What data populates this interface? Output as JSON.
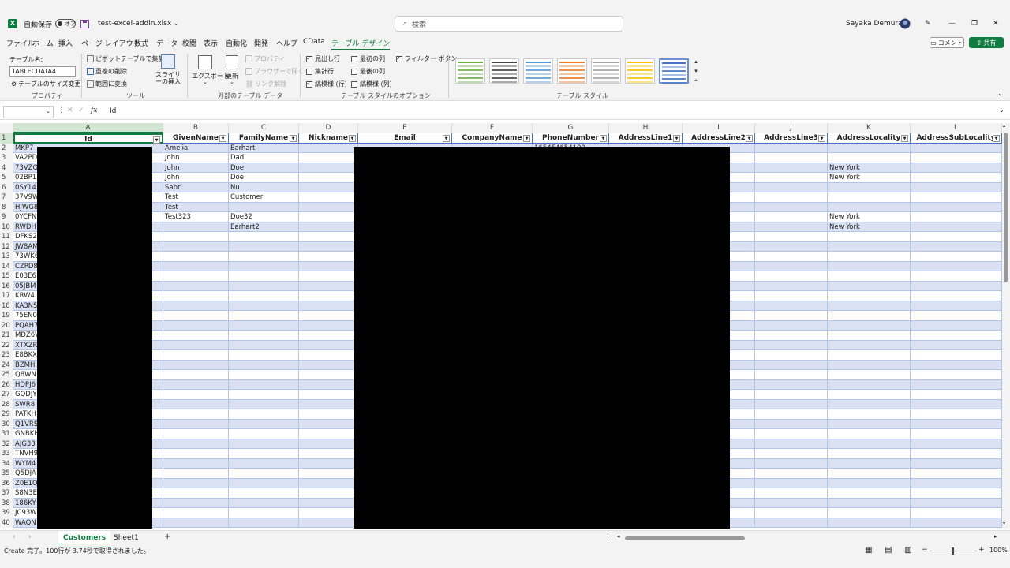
{
  "titlebar": {
    "autosave_label": "自動保存",
    "autosave_state": "オフ",
    "filename": "test-excel-addin.xlsx",
    "search_placeholder": "検索",
    "user_name": "Sayaka Demura"
  },
  "menu": [
    "ファイル",
    "ホーム",
    "挿入",
    "ページ レイアウト",
    "数式",
    "データ",
    "校閲",
    "表示",
    "自動化",
    "開発",
    "ヘルプ",
    "CData",
    "テーブル デザイン"
  ],
  "menu_active_index": 12,
  "comment_label": "コメント",
  "share_label": "共有",
  "ribbon": {
    "table_name_label": "テーブル名:",
    "table_name_value": "TABLECDATA4",
    "resize_label": "テーブルのサイズ変更",
    "group_properties": "プロパティ",
    "pivot_label": "ピボットテーブルで集計",
    "remove_dup_label": "重複の削除",
    "convert_range_label": "範囲に変換",
    "slicer_label": "スライサーの挿入",
    "group_tools": "ツール",
    "export_label": "エクスポート",
    "refresh_label": "更新",
    "property_label": "プロパティ",
    "browser_label": "ブラウザーで開く",
    "unlink_label": "リンク解除",
    "group_external": "外部のテーブル データ",
    "opt_header_row": "見出し行",
    "opt_total_row": "集計行",
    "opt_banded_rows": "縞模様 (行)",
    "opt_first_col": "最初の列",
    "opt_last_col": "最後の列",
    "opt_banded_cols": "縞模様 (列)",
    "opt_filter_btn": "フィルター ボタン",
    "group_style_options": "テーブル スタイルのオプション",
    "group_styles": "テーブル スタイル",
    "style_colors": [
      "#70ad47",
      "#444444",
      "#5b9bd5",
      "#ed7d31",
      "#a5a5a5",
      "#ffc000",
      "#4472c4"
    ]
  },
  "formula": {
    "content": "Id"
  },
  "columns": [
    "A",
    "B",
    "C",
    "D",
    "E",
    "F",
    "G",
    "H",
    "I",
    "J",
    "K",
    "L"
  ],
  "table_headers": [
    "Id",
    "GivenName",
    "FamilyName",
    "Nickname",
    "Email",
    "CompanyName",
    "PhoneNumber",
    "AddressLine1",
    "AddressLine2",
    "AddressLine3",
    "AddressLocality",
    "AddressSubLocality"
  ],
  "rows": [
    {
      "n": "1"
    },
    {
      "n": "2",
      "id": "MKP7",
      "given": "Amelia",
      "family": "Earhart",
      "phone": "165454654109"
    },
    {
      "n": "3",
      "id": "VA2PD",
      "given": "John",
      "family": "Dad"
    },
    {
      "n": "4",
      "id": "73VZQ",
      "given": "John",
      "family": "Doe",
      "locality": "New York"
    },
    {
      "n": "5",
      "id": "02BP1",
      "given": "John",
      "family": "Doe",
      "locality": "New York"
    },
    {
      "n": "6",
      "id": "0SY14",
      "given": "Sabri",
      "family": "Nu"
    },
    {
      "n": "7",
      "id": "37V9W",
      "given": "Test",
      "family": "Customer"
    },
    {
      "n": "8",
      "id": "HJWG8",
      "given": "Test"
    },
    {
      "n": "9",
      "id": "0YCFN",
      "given": "Test323",
      "family": "Doe32",
      "locality": "New York"
    },
    {
      "n": "10",
      "id": "RWDH",
      "family": "Earhart2",
      "locality": "New York"
    },
    {
      "n": "11",
      "id": "DFKS2"
    },
    {
      "n": "12",
      "id": "JW8AM"
    },
    {
      "n": "13",
      "id": "73WK6"
    },
    {
      "n": "14",
      "id": "CZPD8"
    },
    {
      "n": "15",
      "id": "E03E6"
    },
    {
      "n": "16",
      "id": "05JBM"
    },
    {
      "n": "17",
      "id": "KRW4"
    },
    {
      "n": "18",
      "id": "KA3N5"
    },
    {
      "n": "19",
      "id": "75EN0"
    },
    {
      "n": "20",
      "id": "PQAH7"
    },
    {
      "n": "21",
      "id": "MDZ6V"
    },
    {
      "n": "22",
      "id": "XTXZR"
    },
    {
      "n": "23",
      "id": "E8BKX"
    },
    {
      "n": "24",
      "id": "BZMH"
    },
    {
      "n": "25",
      "id": "Q8WN"
    },
    {
      "n": "26",
      "id": "HDPJ6"
    },
    {
      "n": "27",
      "id": "GQDJY"
    },
    {
      "n": "28",
      "id": "SWR8"
    },
    {
      "n": "29",
      "id": "PATKH"
    },
    {
      "n": "30",
      "id": "Q1VRS"
    },
    {
      "n": "31",
      "id": "GNBKH"
    },
    {
      "n": "32",
      "id": "AJG33"
    },
    {
      "n": "33",
      "id": "TNVH9"
    },
    {
      "n": "34",
      "id": "WYM4"
    },
    {
      "n": "35",
      "id": "Q5DJA"
    },
    {
      "n": "36",
      "id": "Z0E1Q"
    },
    {
      "n": "37",
      "id": "S8N3E"
    },
    {
      "n": "38",
      "id": "186KY"
    },
    {
      "n": "39",
      "id": "JC93W"
    },
    {
      "n": "40",
      "id": "WAQN"
    }
  ],
  "sheets": [
    "Customers",
    "Sheet1"
  ],
  "active_sheet_index": 0,
  "status": {
    "message": "Create 完了。100行が 3.74秒で取得されました。",
    "zoom": "100%"
  }
}
